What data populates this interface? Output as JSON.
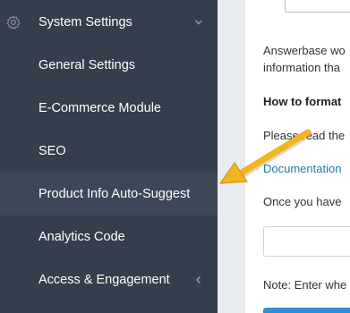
{
  "sidebar": {
    "items": [
      {
        "label": "System Settings",
        "icon": "gear-icon",
        "chevron": "chevron-down-icon"
      },
      {
        "label": "General Settings"
      },
      {
        "label": "E-Commerce Module"
      },
      {
        "label": "SEO"
      },
      {
        "label": "Product Info Auto-Suggest"
      },
      {
        "label": "Analytics Code"
      },
      {
        "label": "Access & Engagement",
        "chevron": "chevron-left-icon"
      }
    ]
  },
  "main": {
    "desc_line1": "Answerbase wo",
    "desc_line2": "information tha",
    "heading": "How to format",
    "instruction": "Please read the",
    "link": "Documentation",
    "once": "Once you have",
    "note": "Note: Enter whe"
  },
  "annotation": {
    "arrow_color": "#f2b51f"
  },
  "colors": {
    "sidebar_bg": "#343e4c",
    "active_bg": "#3c4757",
    "link": "#1f7aa8",
    "button": "#2e8fd6"
  }
}
